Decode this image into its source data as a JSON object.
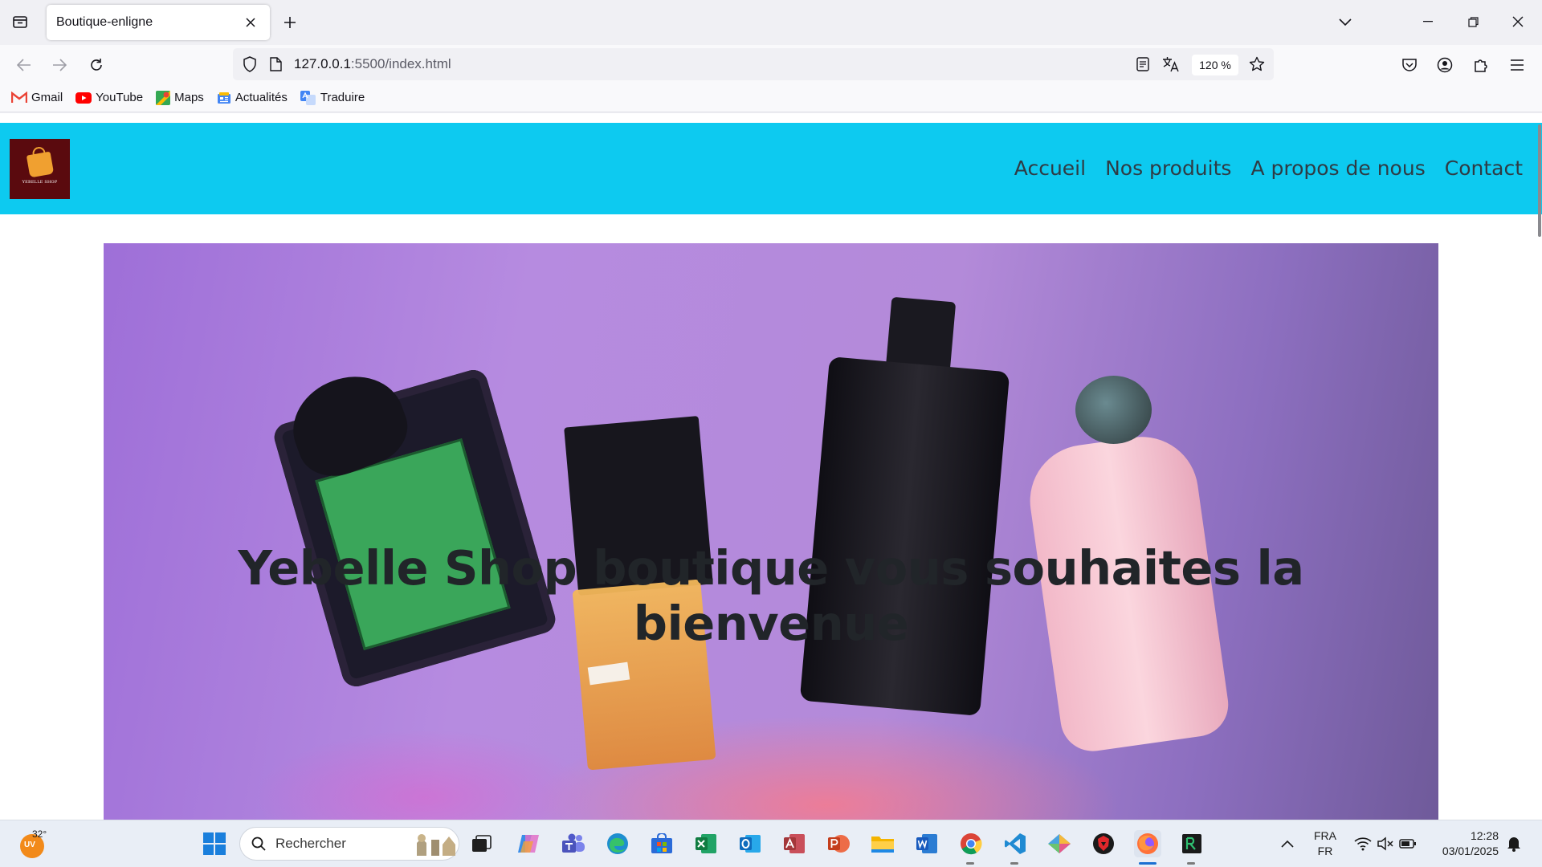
{
  "browser": {
    "tab_title": "Boutique-enligne",
    "url_host": "127.0.0.1",
    "url_rest": ":5500/index.html",
    "zoom": "120 %"
  },
  "bookmarks": [
    {
      "label": "Gmail",
      "icon": "gmail-icon"
    },
    {
      "label": "YouTube",
      "icon": "youtube-icon"
    },
    {
      "label": "Maps",
      "icon": "maps-icon"
    },
    {
      "label": "Actualités",
      "icon": "news-icon"
    },
    {
      "label": "Traduire",
      "icon": "translate-icon"
    }
  ],
  "site": {
    "nav": [
      "Accueil",
      "Nos produits",
      "A propos de nous",
      "Contact"
    ],
    "hero_title": "Yebelle Shop boutique vous souhaites la bienvenue",
    "header_color": "#0dcaf0"
  },
  "taskbar": {
    "temperature": "32°",
    "weather_badge": "UV",
    "search_placeholder": "Rechercher",
    "lang_top": "FRA",
    "lang_bottom": "FR",
    "time": "12:28",
    "date": "03/01/2025"
  }
}
